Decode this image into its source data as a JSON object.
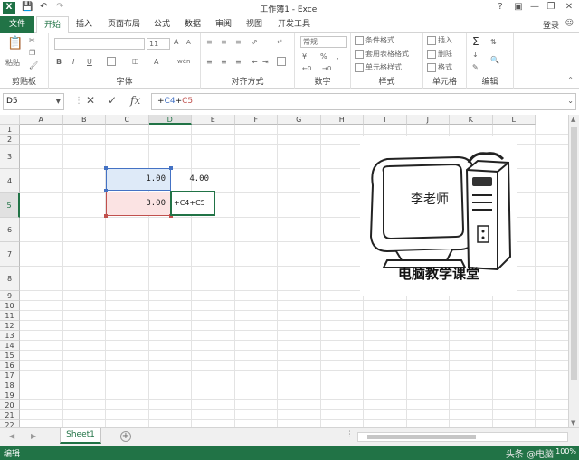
{
  "window": {
    "title": "工作簿1 - Excel",
    "app_icon": "X",
    "help": "?",
    "login": "登录"
  },
  "tabs": [
    "文件",
    "开始",
    "插入",
    "页面布局",
    "公式",
    "数据",
    "审阅",
    "视图",
    "开发工具"
  ],
  "ribbon": {
    "clipboard": {
      "label": "剪贴板",
      "paste": "粘贴"
    },
    "font": {
      "label": "字体",
      "size": "11",
      "bold": "B",
      "italic": "I",
      "underline": "U",
      "increase": "A",
      "decrease": "A",
      "wen": "wén"
    },
    "alignment": {
      "label": "对齐方式"
    },
    "number": {
      "label": "数字",
      "format": "常规",
      "percent": "%",
      "comma": ","
    },
    "styles": {
      "label": "样式",
      "conditional": "条件格式",
      "table": "套用表格格式",
      "cell": "单元格样式"
    },
    "cells": {
      "label": "单元格",
      "insert": "插入",
      "delete": "删除",
      "format": "格式"
    },
    "editing": {
      "label": "编辑",
      "sum": "Σ"
    }
  },
  "formula_bar": {
    "name_box": "D5",
    "fx": "fx",
    "formula_prefix": "+",
    "ref1": "C4",
    "plus": "+",
    "ref2": "C5"
  },
  "columns": [
    "A",
    "B",
    "C",
    "D",
    "E",
    "F",
    "G",
    "H",
    "I",
    "J",
    "K",
    "L"
  ],
  "rows": [
    "1",
    "2",
    "3",
    "4",
    "5",
    "6",
    "7",
    "8",
    "9",
    "10",
    "11",
    "12",
    "13",
    "14",
    "15",
    "16",
    "17",
    "18",
    "19",
    "20",
    "21",
    "22"
  ],
  "cells": {
    "C4": "1.00",
    "D4": "4.00",
    "C5": "3.00",
    "D5": "+C4+C5"
  },
  "picture": {
    "screen_text": "李老师",
    "caption": "电脑教学课堂"
  },
  "sheet": {
    "tab": "Sheet1",
    "add": "+"
  },
  "status": {
    "mode": "编辑",
    "watermark": "头条 @电脑",
    "zoom": "100%"
  },
  "colors": {
    "excel_green": "#217346",
    "ref_blue": "#4472c4",
    "ref_red": "#c0504d"
  }
}
